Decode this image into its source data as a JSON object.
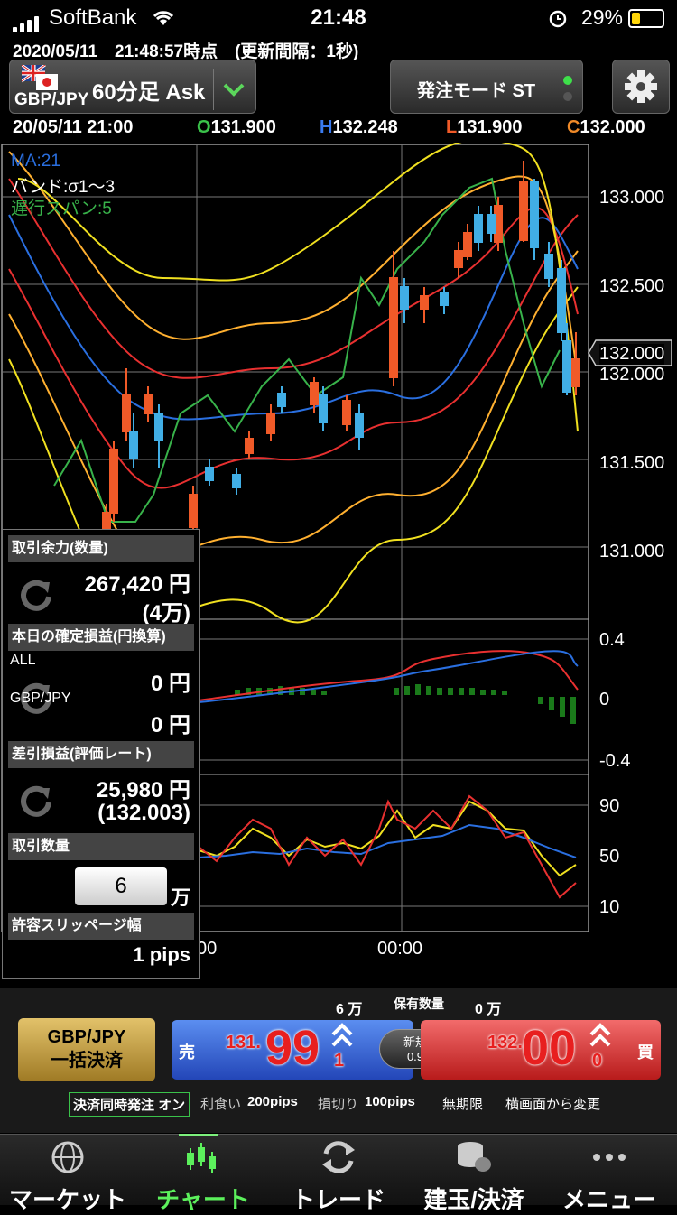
{
  "status_bar": {
    "carrier": "SoftBank",
    "time": "21:48",
    "battery": "29%"
  },
  "header": {
    "updated": "2020/05/11　21:48:57時点　(更新間隔：1秒)",
    "pair": "GBP/JPY",
    "timeframe": "60分足 Ask",
    "mode": "発注モード ST"
  },
  "ohlc": {
    "date": "20/05/11 21:00",
    "o_label": "O",
    "o": "131.900",
    "h_label": "H",
    "h": "132.248",
    "l_label": "L",
    "l": "131.900",
    "c_label": "C",
    "c": "132.000"
  },
  "chart": {
    "legend_ma": "MA:21",
    "legend_band": "バンド:σ1～3",
    "legend_span": "遅行スパン:5",
    "price_ticks": [
      "133.000",
      "132.500",
      "132.000",
      "131.500",
      "131.000"
    ],
    "current_price": "132.000",
    "macd_ticks": [
      "0.4",
      "0",
      "-0.4"
    ],
    "rsi_ticks": [
      "90",
      "50",
      "10"
    ],
    "time_labels": [
      "00",
      "00:00"
    ],
    "colors": {
      "up": "#f05a28",
      "down": "#41aee5",
      "ma": "#2a6fe0",
      "band1": "#e83030",
      "band2": "#ffb030",
      "band3": "#f0e020",
      "span": "#38b24a"
    }
  },
  "panel": {
    "margin_label": "取引余力(数量)",
    "margin_value": "267,420 円",
    "margin_qty": "(4万)",
    "pl_label": "本日の確定損益(円換算)",
    "all_label": "ALL",
    "all_value": "0 円",
    "pair_label": "GBP/JPY",
    "pair_value": "0 円",
    "eval_label": "差引損益(評価レート)",
    "eval_value": "25,980 円",
    "eval_rate": "(132.003)",
    "qty_label": "取引数量",
    "qty_value": "6",
    "qty_unit": "万",
    "slip_label": "許容スリッページ幅",
    "slip_value": "1 pips"
  },
  "trade": {
    "sell_qty": "6 万",
    "hold_label": "保有数量",
    "buy_qty": "0 万",
    "settle_line1": "GBP/JPY",
    "settle_line2": "一括決済",
    "sell_label": "売",
    "sell_small": "131.",
    "sell_big": "99",
    "sell_pip": "1",
    "spread_label": "新規",
    "spread_value": "0.9",
    "buy_label": "買",
    "buy_small": "132.",
    "buy_big": "00",
    "buy_pip": "0"
  },
  "order_settings": {
    "simul": "決済同時発注 オン",
    "tp_label": "利食い",
    "tp": "200pips",
    "sl_label": "損切り",
    "sl": "100pips",
    "expiry": "無期限",
    "landscape": "横画面から変更"
  },
  "tabs": [
    {
      "label": "マーケット",
      "icon": "globe-icon",
      "active": false
    },
    {
      "label": "チャート",
      "icon": "candle-chart-icon",
      "active": true
    },
    {
      "label": "トレード",
      "icon": "trade-arrows-icon",
      "active": false
    },
    {
      "label": "建玉/決済",
      "icon": "coins-icon",
      "active": false
    },
    {
      "label": "メニュー",
      "icon": "more-dots-icon",
      "active": false
    }
  ]
}
